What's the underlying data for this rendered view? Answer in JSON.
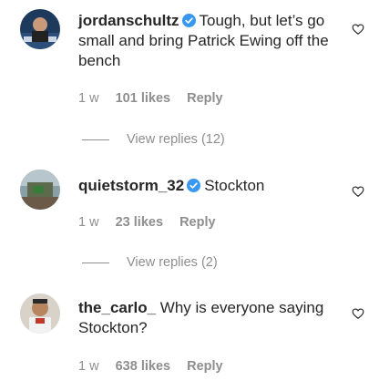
{
  "comments": [
    {
      "username": "jordanschultz",
      "verified": true,
      "text": "Tough, but let’s go small and bring Patrick Ewing off the bench",
      "time": "1 w",
      "likes": "101 likes",
      "reply": "Reply",
      "view_replies": "View replies (12)"
    },
    {
      "username": "quietstorm_32",
      "verified": true,
      "text": "Stockton",
      "time": "1 w",
      "likes": "23 likes",
      "reply": "Reply",
      "view_replies": "View replies (2)"
    },
    {
      "username": "the_carlo_",
      "verified": false,
      "text": "Why is everyone saying Stockton?",
      "time": "1 w",
      "likes": "638 likes",
      "reply": "Reply"
    }
  ],
  "icons": {
    "verified": "verified-badge-icon",
    "like": "heart-outline-icon"
  },
  "colors": {
    "text": "#262626",
    "secondary": "#8e8e8e",
    "verified": "#3897f0"
  }
}
